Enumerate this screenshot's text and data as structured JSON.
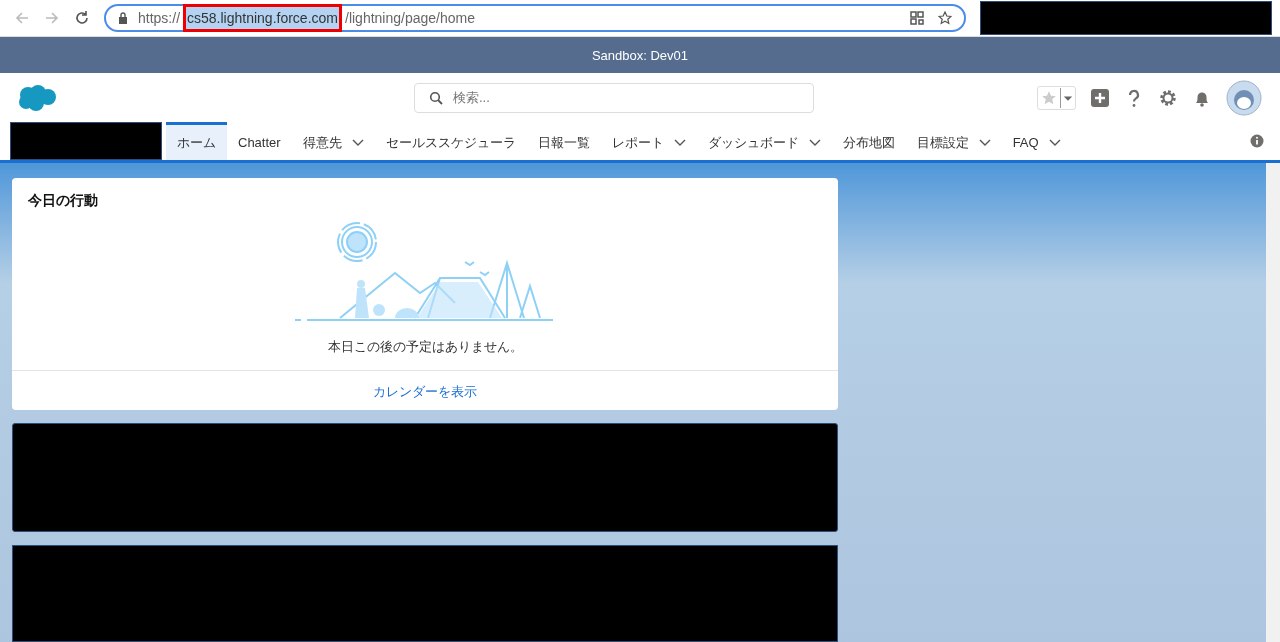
{
  "browser": {
    "url_scheme": "https://",
    "url_host": "cs58.lightning.force.com",
    "url_path": "/lightning/page/home",
    "host_highlighted": true
  },
  "sandbox_banner": "Sandbox: Dev01",
  "search": {
    "placeholder": "検索..."
  },
  "nav": [
    {
      "label": "ホーム",
      "has_menu": false,
      "selected": true
    },
    {
      "label": "Chatter",
      "has_menu": false,
      "selected": false
    },
    {
      "label": "得意先",
      "has_menu": true,
      "selected": false
    },
    {
      "label": "セールススケジューラ",
      "has_menu": false,
      "selected": false
    },
    {
      "label": "日報一覧",
      "has_menu": false,
      "selected": false
    },
    {
      "label": "レポート",
      "has_menu": true,
      "selected": false
    },
    {
      "label": "ダッシュボード",
      "has_menu": true,
      "selected": false
    },
    {
      "label": "分布地図",
      "has_menu": false,
      "selected": false
    },
    {
      "label": "目標設定",
      "has_menu": true,
      "selected": false
    },
    {
      "label": "FAQ",
      "has_menu": true,
      "selected": false
    }
  ],
  "events_card": {
    "title": "今日の行動",
    "empty_message": "本日この後の予定はありません。",
    "footer_link": "カレンダーを表示"
  }
}
